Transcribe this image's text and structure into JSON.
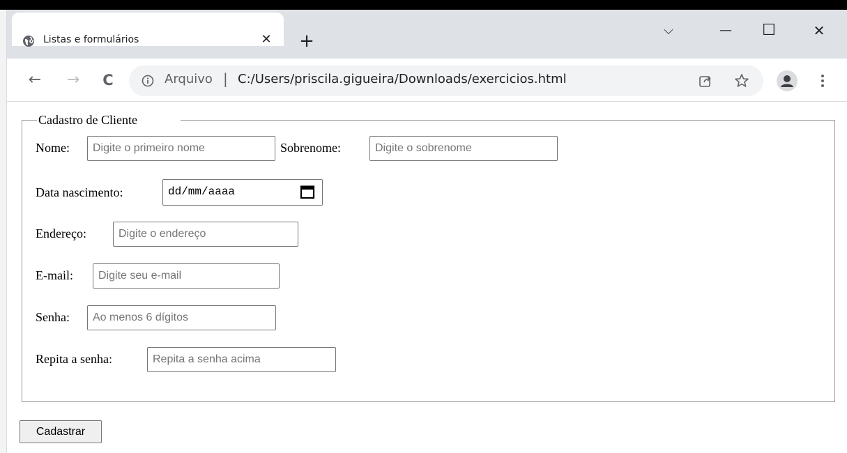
{
  "browser": {
    "tab": {
      "title": "Listas e formulários",
      "close_glyph": "✕"
    },
    "new_tab_glyph": "+",
    "window_controls": {
      "dropdown_glyph": "⌵",
      "minimize_glyph": "—",
      "maximize_glyph": "☐",
      "close_glyph": "✕"
    },
    "nav": {
      "back_glyph": "←",
      "forward_glyph": "→",
      "reload_glyph": "C"
    },
    "address": {
      "scheme_label": "Arquivo",
      "separator": "|",
      "path": "C:/Users/priscila.gigueira/Downloads/exercicios.html"
    },
    "icons": [
      "globe-icon",
      "info-icon",
      "share-icon",
      "star-icon",
      "profile-icon",
      "more-vert-icon"
    ]
  },
  "form": {
    "legend": "Cadastro de Cliente",
    "nome": {
      "label": "Nome:",
      "placeholder": "Digite o primeiro nome"
    },
    "sobrenome": {
      "label": "Sobrenome:",
      "placeholder": "Digite o sobrenome"
    },
    "data_nascimento": {
      "label": "Data nascimento:",
      "value_format": "dd/mm/aaaa"
    },
    "endereco": {
      "label": "Endereço:",
      "placeholder": "Digite o endereço"
    },
    "email": {
      "label": "E-mail:",
      "placeholder": "Digite seu e-mail"
    },
    "senha": {
      "label": "Senha:",
      "placeholder": "Ao menos 6 dígitos"
    },
    "repita_senha": {
      "label": "Repita a senha:",
      "placeholder": "Repita a senha acima"
    },
    "submit_label": "Cadastrar"
  },
  "colors": {
    "chrome_background": "#dee1e6",
    "omnibox_background": "#f1f3f4",
    "accent": "#1a73e8",
    "input_border": "#767676"
  }
}
